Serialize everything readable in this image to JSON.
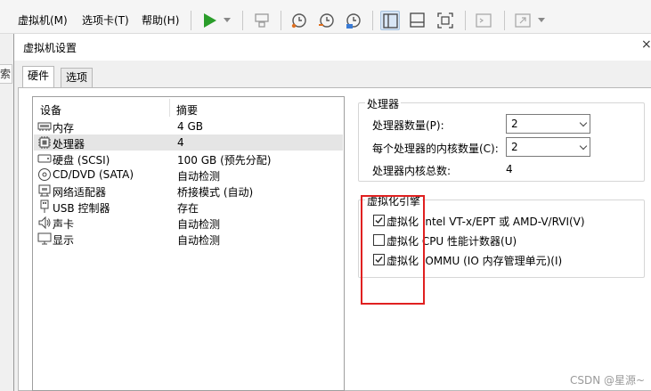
{
  "menubar": {
    "items": [
      {
        "label": "虚拟机(M)"
      },
      {
        "label": "选项卡(T)"
      },
      {
        "label": "帮助(H)"
      }
    ],
    "icons": [
      "play-icon",
      "send-keys-icon",
      "snapshot-icon",
      "revert-snapshot-icon",
      "snapshot-manager-icon",
      "single-view-icon",
      "console-view-icon",
      "fullscreen-icon",
      "terminal-icon",
      "stretch-icon"
    ]
  },
  "behind": {
    "tab_fragment": "索"
  },
  "dialog": {
    "title": "虚拟机设置",
    "close_glyph": "×",
    "tabs": [
      {
        "label": "硬件",
        "active": true
      },
      {
        "label": "选项",
        "active": false
      }
    ]
  },
  "device_list": {
    "headers": {
      "device": "设备",
      "summary": "摘要"
    },
    "rows": [
      {
        "icon": "memory-icon",
        "name": "内存",
        "summary": "4 GB",
        "selected": false
      },
      {
        "icon": "processor-icon",
        "name": "处理器",
        "summary": "4",
        "selected": true
      },
      {
        "icon": "hard-disk-icon",
        "name": "硬盘 (SCSI)",
        "summary": "100 GB (预先分配)",
        "selected": false
      },
      {
        "icon": "cd-dvd-icon",
        "name": "CD/DVD (SATA)",
        "summary": "自动检测",
        "selected": false
      },
      {
        "icon": "network-adapter-icon",
        "name": "网络适配器",
        "summary": "桥接模式 (自动)",
        "selected": false
      },
      {
        "icon": "usb-icon",
        "name": "USB 控制器",
        "summary": "存在",
        "selected": false
      },
      {
        "icon": "sound-card-icon",
        "name": "声卡",
        "summary": "自动检测",
        "selected": false
      },
      {
        "icon": "display-icon",
        "name": "显示",
        "summary": "自动检测",
        "selected": false
      }
    ]
  },
  "processor": {
    "legend": "处理器",
    "count_label": "处理器数量(P):",
    "count_value": "2",
    "cores_label": "每个处理器的内核数量(C):",
    "cores_value": "2",
    "total_label": "处理器内核总数:",
    "total_value": "4"
  },
  "virtualization": {
    "legend": "虚拟化引擎",
    "options": [
      {
        "label": "虚拟化 Intel VT-x/EPT 或 AMD-V/RVI(V)",
        "checked": true
      },
      {
        "label": "虚拟化 CPU 性能计数器(U)",
        "checked": false
      },
      {
        "label": "虚拟化 IOMMU (IO 内存管理单元)(I)",
        "checked": true
      }
    ]
  },
  "watermark": "CSDN @星源~",
  "colors": {
    "highlight": "#e02020",
    "play": "#2a9d2a",
    "selected_row": "#e5e5e5"
  }
}
